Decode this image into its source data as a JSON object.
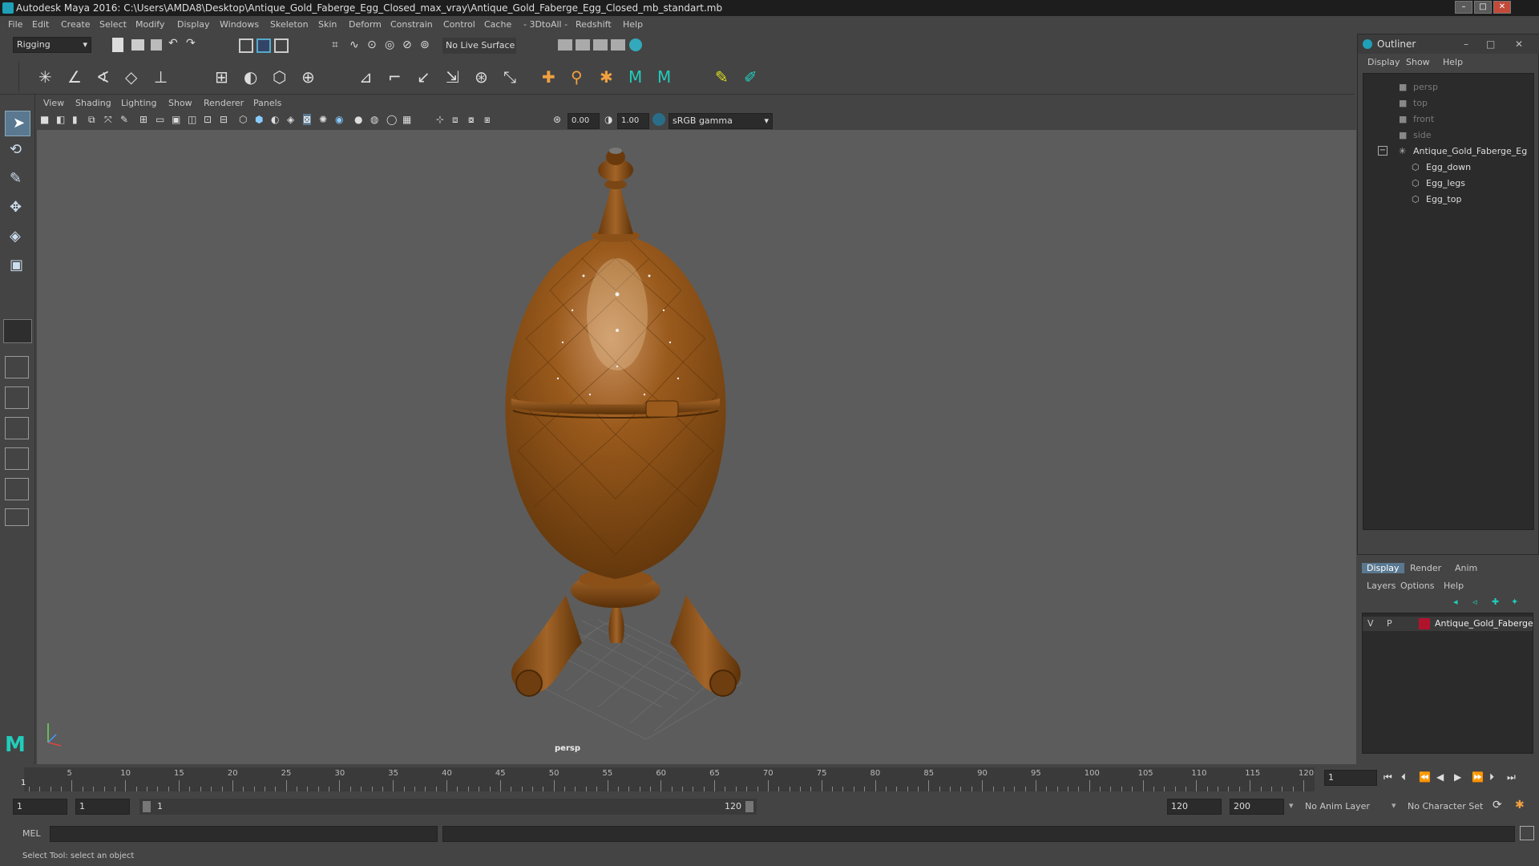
{
  "title": "Autodesk Maya 2016: C:\\Users\\AMDA8\\Desktop\\Antique_Gold_Faberge_Egg_Closed_max_vray\\Antique_Gold_Faberge_Egg_Closed_mb_standart.mb",
  "menu": [
    "File",
    "Edit",
    "Create",
    "Select",
    "Modify",
    "Display",
    "Windows",
    "Skeleton",
    "Skin",
    "Deform",
    "Constrain",
    "Control",
    "Cache",
    "- 3DtoAll -",
    "Redshift",
    "Help"
  ],
  "mode": "Rigging",
  "live_surface": "No Live Surface",
  "viewport_menu": [
    "View",
    "Shading",
    "Lighting",
    "Show",
    "Renderer",
    "Panels"
  ],
  "viewport": {
    "val1": "0.00",
    "val2": "1.00",
    "colorspace": "sRGB gamma",
    "camera_label": "persp"
  },
  "outliner": {
    "title": "Outliner",
    "menu": [
      "Display",
      "Show",
      "Help"
    ],
    "items": [
      {
        "label": "persp",
        "type": "camera"
      },
      {
        "label": "top",
        "type": "camera"
      },
      {
        "label": "front",
        "type": "camera"
      },
      {
        "label": "side",
        "type": "camera"
      },
      {
        "label": "Antique_Gold_Faberge_Eg",
        "type": "group"
      },
      {
        "label": "Egg_down",
        "type": "mesh"
      },
      {
        "label": "Egg_legs",
        "type": "mesh"
      },
      {
        "label": "Egg_top",
        "type": "mesh"
      }
    ]
  },
  "layers": {
    "tabs": [
      "Display",
      "Render",
      "Anim"
    ],
    "menu": [
      "Layers",
      "Options",
      "Help"
    ],
    "row": {
      "v": "V",
      "p": "P",
      "name": "Antique_Gold_Faberge",
      "color": "#b0142c"
    }
  },
  "timeline": {
    "labels": [
      "5",
      "10",
      "15",
      "20",
      "25",
      "30",
      "35",
      "40",
      "45",
      "50",
      "55",
      "60",
      "65",
      "70",
      "75",
      "80",
      "85",
      "90",
      "95",
      "100",
      "105",
      "110",
      "115",
      "120"
    ],
    "current": "1",
    "current_field": "1"
  },
  "range": {
    "start": "1",
    "inner_start": "1",
    "slider_start": "1",
    "slider_end": "120",
    "end": "120",
    "max": "200",
    "anim_layer": "No Anim Layer",
    "char_set": "No Character Set"
  },
  "cmd": {
    "lang": "MEL"
  },
  "status": "Select Tool: select an object",
  "colors": {
    "egg": "#8a4f12",
    "egg_light": "#c08850",
    "viewport_bg": "#5c5c5c"
  }
}
